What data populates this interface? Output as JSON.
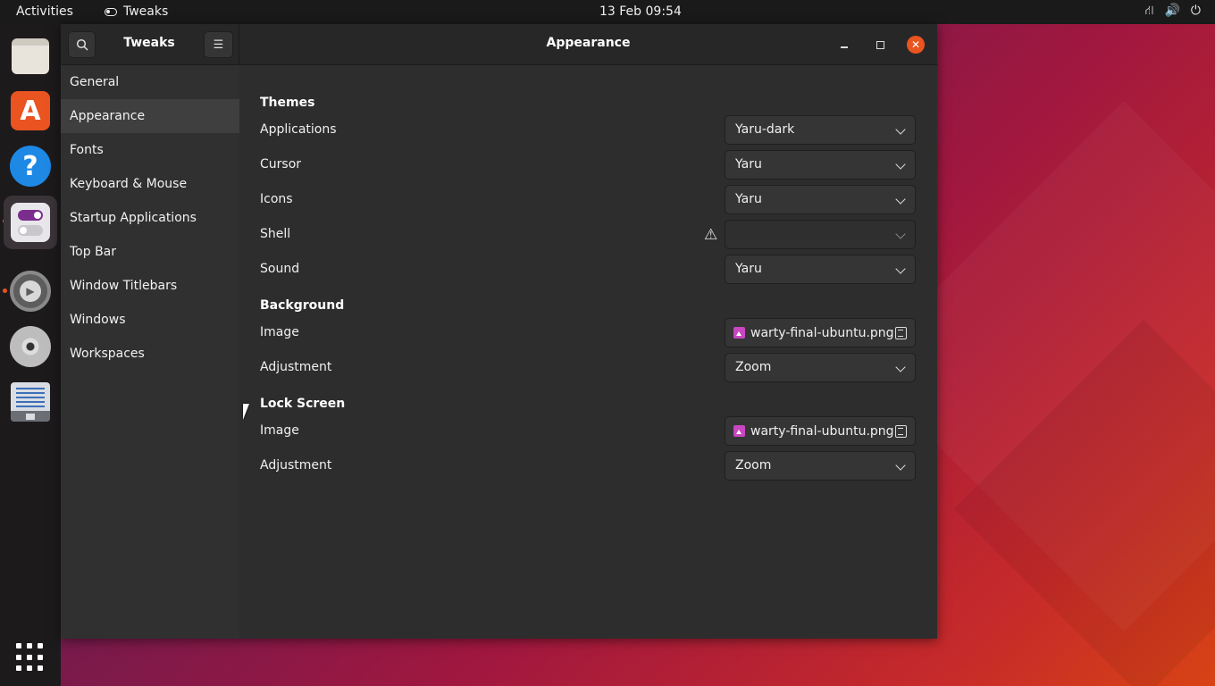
{
  "topbar": {
    "activities": "Activities",
    "app_name": "Tweaks",
    "clock": "13 Feb  09:54",
    "tray": {
      "network": "⛙",
      "volume": "🔊",
      "power": "⏻"
    }
  },
  "dock": {
    "icons": [
      "files-icon",
      "app-store-icon",
      "help-icon",
      "tweaks-icon",
      "settings-icon",
      "disc-icon",
      "text-editor-icon",
      "app-grid-icon"
    ]
  },
  "window": {
    "sidebar_title": "Tweaks",
    "title": "Appearance",
    "menu_glyph": "☰",
    "close_glyph": "✕"
  },
  "sidebar": {
    "items": [
      {
        "label": "General"
      },
      {
        "label": "Appearance"
      },
      {
        "label": "Fonts"
      },
      {
        "label": "Keyboard & Mouse"
      },
      {
        "label": "Startup Applications"
      },
      {
        "label": "Top Bar"
      },
      {
        "label": "Window Titlebars"
      },
      {
        "label": "Windows"
      },
      {
        "label": "Workspaces"
      }
    ],
    "active": "Appearance"
  },
  "themes": {
    "heading": "Themes",
    "applications": {
      "label": "Applications",
      "value": "Yaru-dark"
    },
    "cursor": {
      "label": "Cursor",
      "value": "Yaru"
    },
    "icons": {
      "label": "Icons",
      "value": "Yaru"
    },
    "shell": {
      "label": "Shell",
      "value": "",
      "warning_glyph": "⚠"
    },
    "sound": {
      "label": "Sound",
      "value": "Yaru"
    }
  },
  "background": {
    "heading": "Background",
    "image": {
      "label": "Image",
      "value": "warty-final-ubuntu.png"
    },
    "adjustment": {
      "label": "Adjustment",
      "value": "Zoom"
    }
  },
  "lock_screen": {
    "heading": "Lock Screen",
    "image": {
      "label": "Image",
      "value": "warty-final-ubuntu.png"
    },
    "adjustment": {
      "label": "Adjustment",
      "value": "Zoom"
    }
  },
  "colors": {
    "accent": "#e95420",
    "window_bg": "#2d2d2d",
    "sidebar_bg": "#303030",
    "topbar_bg": "#1a1a1a"
  }
}
